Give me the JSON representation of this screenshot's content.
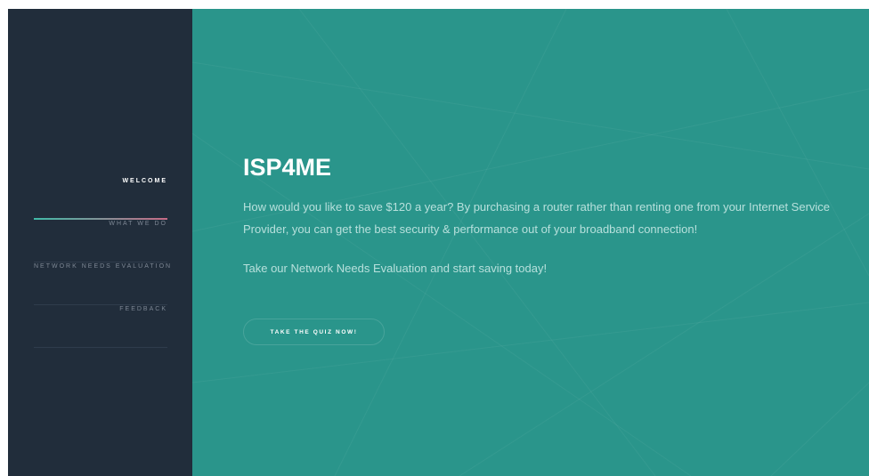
{
  "sidebar": {
    "items": [
      {
        "label": "WELCOME"
      },
      {
        "label": "WHAT WE DO"
      },
      {
        "label": "NETWORK NEEDS EVALUATION"
      },
      {
        "label": "FEEDBACK"
      }
    ]
  },
  "main": {
    "title": "ISP4ME",
    "description": "How would you like to save $120 a year? By purchasing a router rather than renting one from your Internet Service Provider, you can get the best security & performance out of your broadband connection!",
    "cta_text": "Take our Network Needs Evaluation and start saving today!",
    "button_label": "TAKE THE QUIZ NOW!"
  },
  "colors": {
    "sidebar_bg": "#212d3b",
    "main_bg": "#2a958b",
    "accent_start": "#3fbba8",
    "accent_end": "#c86a86"
  }
}
